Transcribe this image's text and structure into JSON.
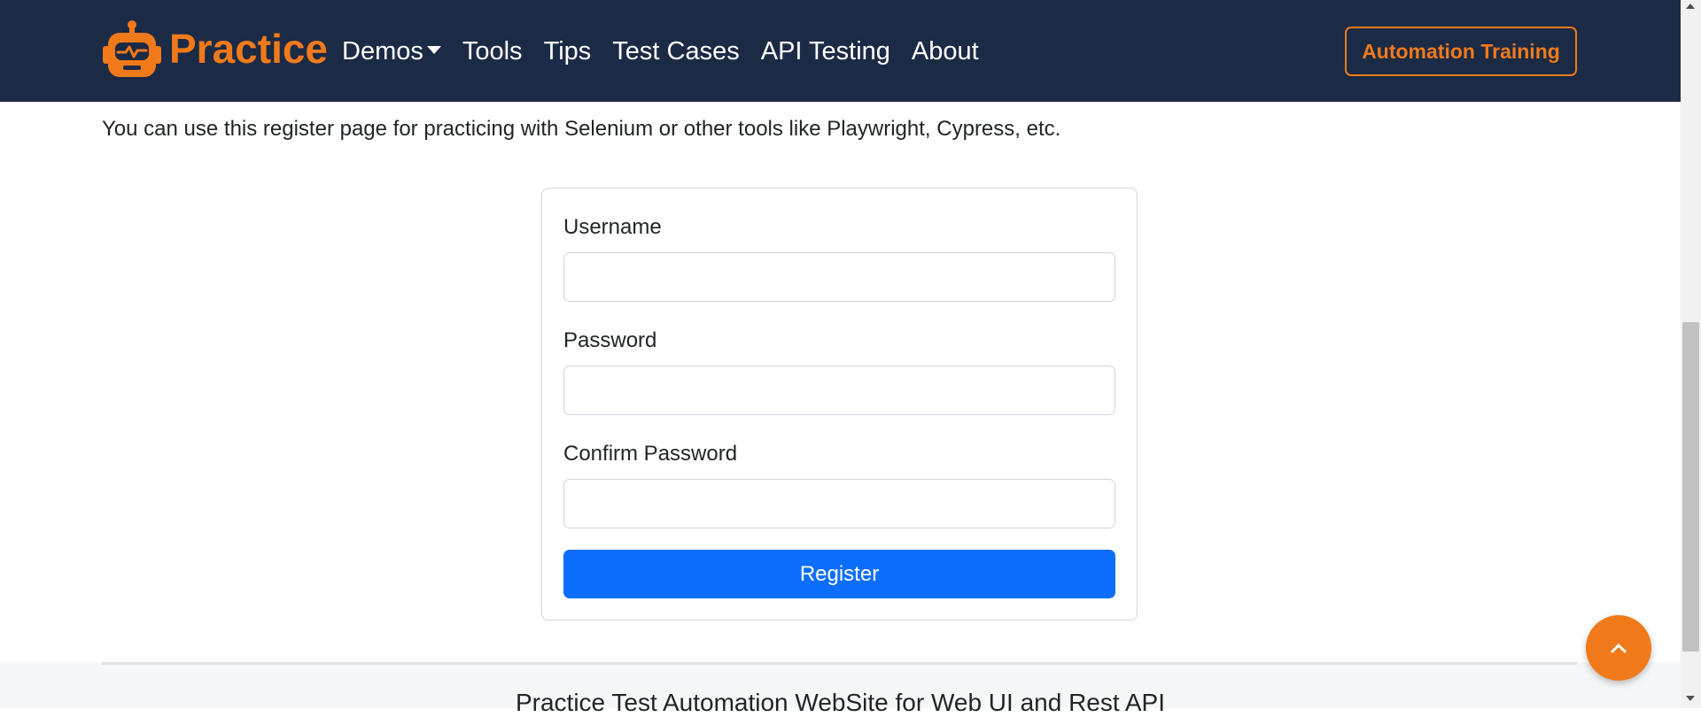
{
  "nav": {
    "brand": "Practice",
    "links": [
      {
        "label": "Demos",
        "has_dropdown": true
      },
      {
        "label": "Tools"
      },
      {
        "label": "Tips"
      },
      {
        "label": "Test Cases"
      },
      {
        "label": "API Testing"
      },
      {
        "label": "About"
      }
    ],
    "cta_label": "Automation Training"
  },
  "intro_text": "You can use this register page for practicing with Selenium or other tools like Playwright, Cypress, etc.",
  "form": {
    "username_label": "Username",
    "username_value": "",
    "password_label": "Password",
    "password_value": "",
    "confirm_label": "Confirm Password",
    "confirm_value": "",
    "submit_label": "Register"
  },
  "footer": {
    "title": "Practice Test Automation WebSite for Web UI and Rest API"
  },
  "icons": {
    "brand": "robot-logo-icon",
    "dropdown": "caret-down-icon",
    "scroll_top": "chevron-up-icon"
  },
  "colors": {
    "navbar_bg": "#1b2a45",
    "accent_orange": "#f07a1a",
    "primary_blue": "#0d6efd"
  }
}
